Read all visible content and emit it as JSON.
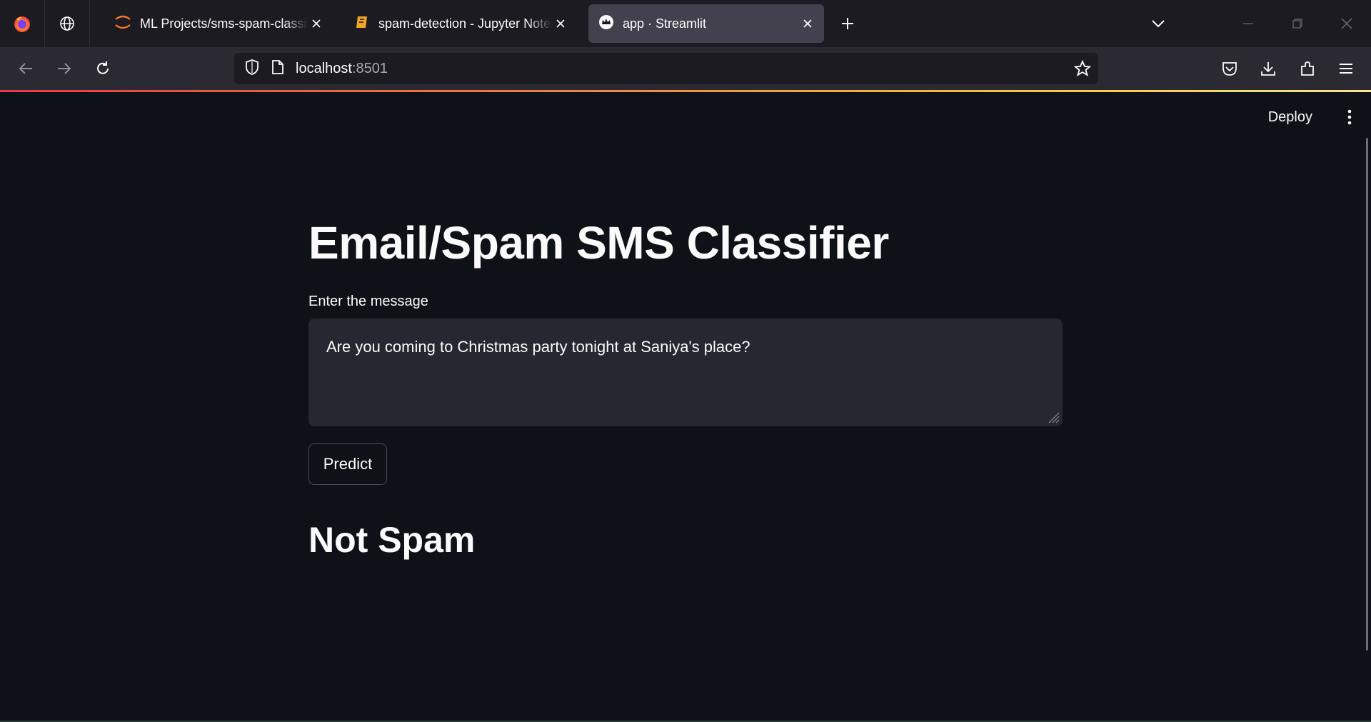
{
  "browser": {
    "tabs": [
      {
        "title": "ML Projects/sms-spam-classifier",
        "icon": "jupyter-icon",
        "active": false
      },
      {
        "title": "spam-detection - Jupyter Notebook",
        "icon": "notebook-icon",
        "active": false
      },
      {
        "title": "app · Streamlit",
        "icon": "streamlit-crown-icon",
        "active": true
      }
    ],
    "url": {
      "host": "localhost",
      "port": ":8501"
    }
  },
  "app": {
    "deploy_label": "Deploy",
    "title": "Email/Spam SMS Classifier",
    "input_label": "Enter the message",
    "message": "Are you coming to Christmas party tonight at Saniya's place?",
    "predict_label": "Predict",
    "result": "Not Spam"
  },
  "colors": {
    "background": "#0e1117",
    "input_bg": "#262730",
    "tab_active": "#42414d",
    "chrome_dark": "#1c1b22"
  }
}
